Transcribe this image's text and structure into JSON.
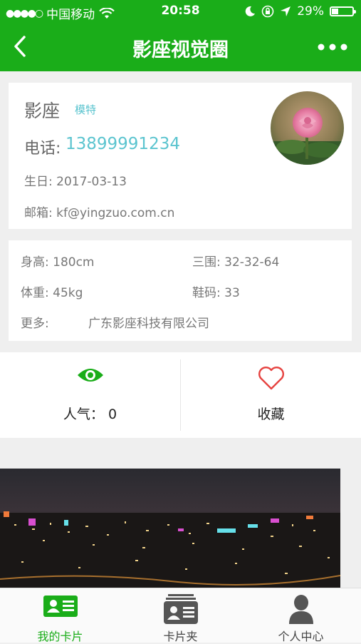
{
  "status_bar": {
    "signal": "●●●●○",
    "carrier": "中国移动",
    "time": "20:58",
    "battery": "29%",
    "battery_level": 0.29
  },
  "nav": {
    "title": "影座视觉圈",
    "back_icon": "chevron-left-icon",
    "more_icon": "more-dots-icon"
  },
  "profile": {
    "name": "影座",
    "role": "模特",
    "phone_label": "电话:",
    "phone": "13899991234",
    "birthday": "生日: 2017-03-13",
    "email": "邮箱: kf@yingzuo.com.cn"
  },
  "stats": {
    "height": "身高: 180cm",
    "measurements": "三围: 32-32-64",
    "weight": "体重: 45kg",
    "shoe": "鞋码: 33",
    "more_label": "更多:",
    "more_value": "广东影座科技有限公司"
  },
  "actions": {
    "popularity": "人气：  0",
    "favorite": "收藏"
  },
  "tabs": [
    {
      "label": "我的卡片",
      "icon": "id-card-icon",
      "active": true
    },
    {
      "label": "卡片夹",
      "icon": "card-holder-icon",
      "active": false
    },
    {
      "label": "个人中心",
      "icon": "person-icon",
      "active": false
    }
  ],
  "colors": {
    "brand": "#1aad19",
    "accent": "#5bc4cf",
    "heart": "#e64340"
  }
}
